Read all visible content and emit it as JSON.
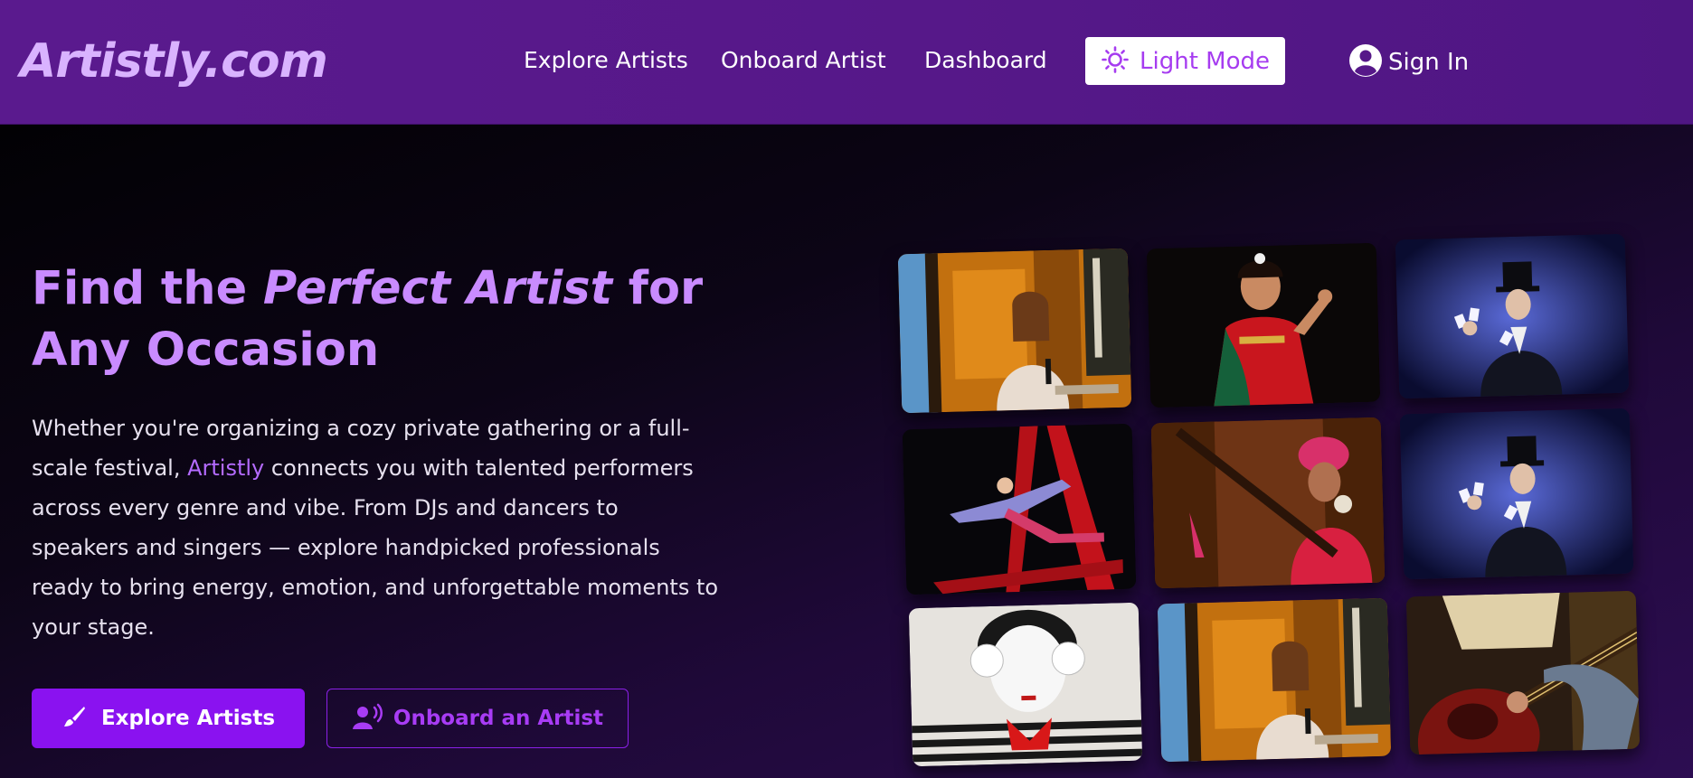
{
  "brand": {
    "name": "Artistly.com",
    "accent": "#a63cf0",
    "nav_bg": "#5a1a8e"
  },
  "nav": {
    "links": [
      "Explore Artists",
      "Onboard Artist",
      "Dashboard"
    ],
    "theme_toggle": {
      "label": "Light Mode",
      "icon": "sun-icon"
    },
    "sign_in": {
      "label": "Sign In",
      "icon": "user-circle-icon"
    }
  },
  "hero": {
    "headline_part1": "Find the ",
    "headline_emphasis": "Perfect Artist",
    "headline_part2": " for Any Occasion",
    "description_part1": "Whether you're organizing a cozy private gathering or a full-scale festival, ",
    "description_brand": "Artistly",
    "description_part2": " connects you with talented performers across every genre and vibe. From DJs and dancers to speakers and singers — explore handpicked professionals ready to bring energy, emotion, and unforgettable moments to your stage.",
    "primary_button": {
      "label": "Explore Artists",
      "icon": "paintbrush-icon"
    },
    "secondary_button": {
      "label": "Onboard an Artist",
      "icon": "user-voice-icon"
    }
  },
  "gallery": [
    {
      "subject": "speaker-with-microphone"
    },
    {
      "subject": "classical-dancer"
    },
    {
      "subject": "magician-with-cards"
    },
    {
      "subject": "aerial-silk-acrobat"
    },
    {
      "subject": "folk-musician-with-instrument"
    },
    {
      "subject": "magician-with-cards"
    },
    {
      "subject": "mime-performer"
    },
    {
      "subject": "speaker-with-microphone"
    },
    {
      "subject": "electric-guitarist"
    }
  ]
}
